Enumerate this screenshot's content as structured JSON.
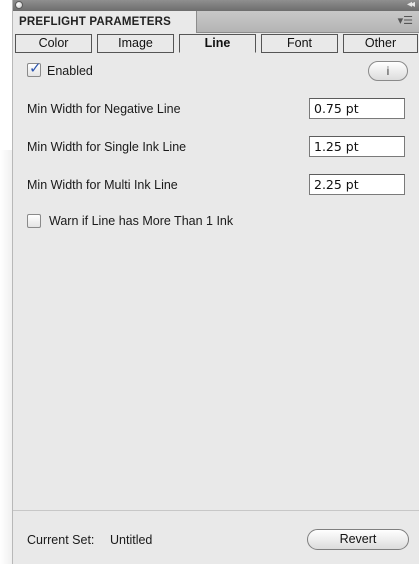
{
  "panel": {
    "title": "PREFLIGHT PARAMETERS",
    "menu_icon": "panel-menu-icon",
    "collapse_icon": "collapse-icon"
  },
  "tabs": [
    {
      "label": "Color",
      "active": false
    },
    {
      "label": "Image",
      "active": false
    },
    {
      "label": "Line",
      "active": true
    },
    {
      "label": "Font",
      "active": false
    },
    {
      "label": "Other",
      "active": false
    }
  ],
  "enabled": {
    "label": "Enabled",
    "checked": true
  },
  "info_button": {
    "label": "i"
  },
  "fields": [
    {
      "label": "Min Width for Negative Line",
      "value": "0.75 pt"
    },
    {
      "label": "Min Width for Single Ink Line",
      "value": "1.25 pt"
    },
    {
      "label": "Min Width for Multi Ink Line",
      "value": "2.25 pt"
    }
  ],
  "warn": {
    "label": "Warn if Line has More Than 1 Ink",
    "checked": false
  },
  "footer": {
    "current_set_label": "Current Set:",
    "current_set_value": "Untitled",
    "revert_label": "Revert"
  },
  "colors": {
    "panel_bg": "#e9e9e9",
    "checkmark": "#2e57b0",
    "titlebar": "#7a7a7a"
  }
}
